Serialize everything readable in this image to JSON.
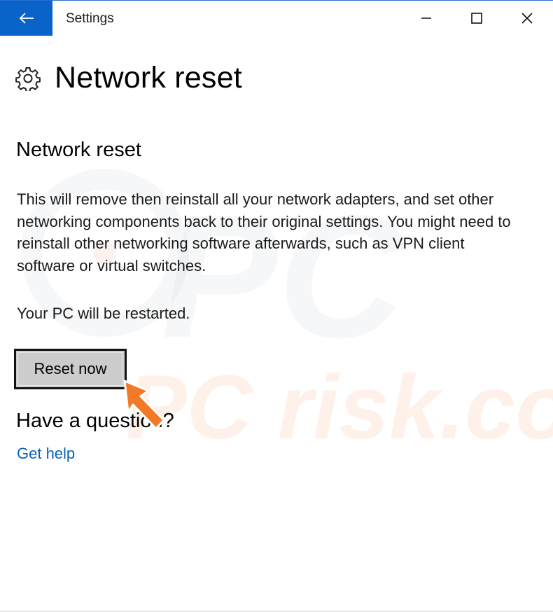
{
  "window": {
    "title": "Settings",
    "accent_color": "#0a63c8"
  },
  "titlebar": {
    "back_icon": "back-arrow-icon",
    "minimize_icon": "minimize-icon",
    "maximize_icon": "maximize-icon",
    "close_icon": "close-icon"
  },
  "page": {
    "icon": "gear-icon",
    "title": "Network reset"
  },
  "section": {
    "title": "Network reset",
    "description": "This will remove then reinstall all your network adapters, and set other networking components back to their original settings. You might need to reinstall other networking software afterwards, such as VPN client software or virtual switches.",
    "restart_note": "Your PC will be restarted.",
    "reset_button_label": "Reset now"
  },
  "help": {
    "title": "Have a question?",
    "link_label": "Get help",
    "link_color": "#0a62b8"
  },
  "watermark": {
    "text": "PC risk.com",
    "color": "#f07c3c"
  },
  "annotation": {
    "icon": "orange-pointer-arrow-icon",
    "color": "#f07a28"
  }
}
